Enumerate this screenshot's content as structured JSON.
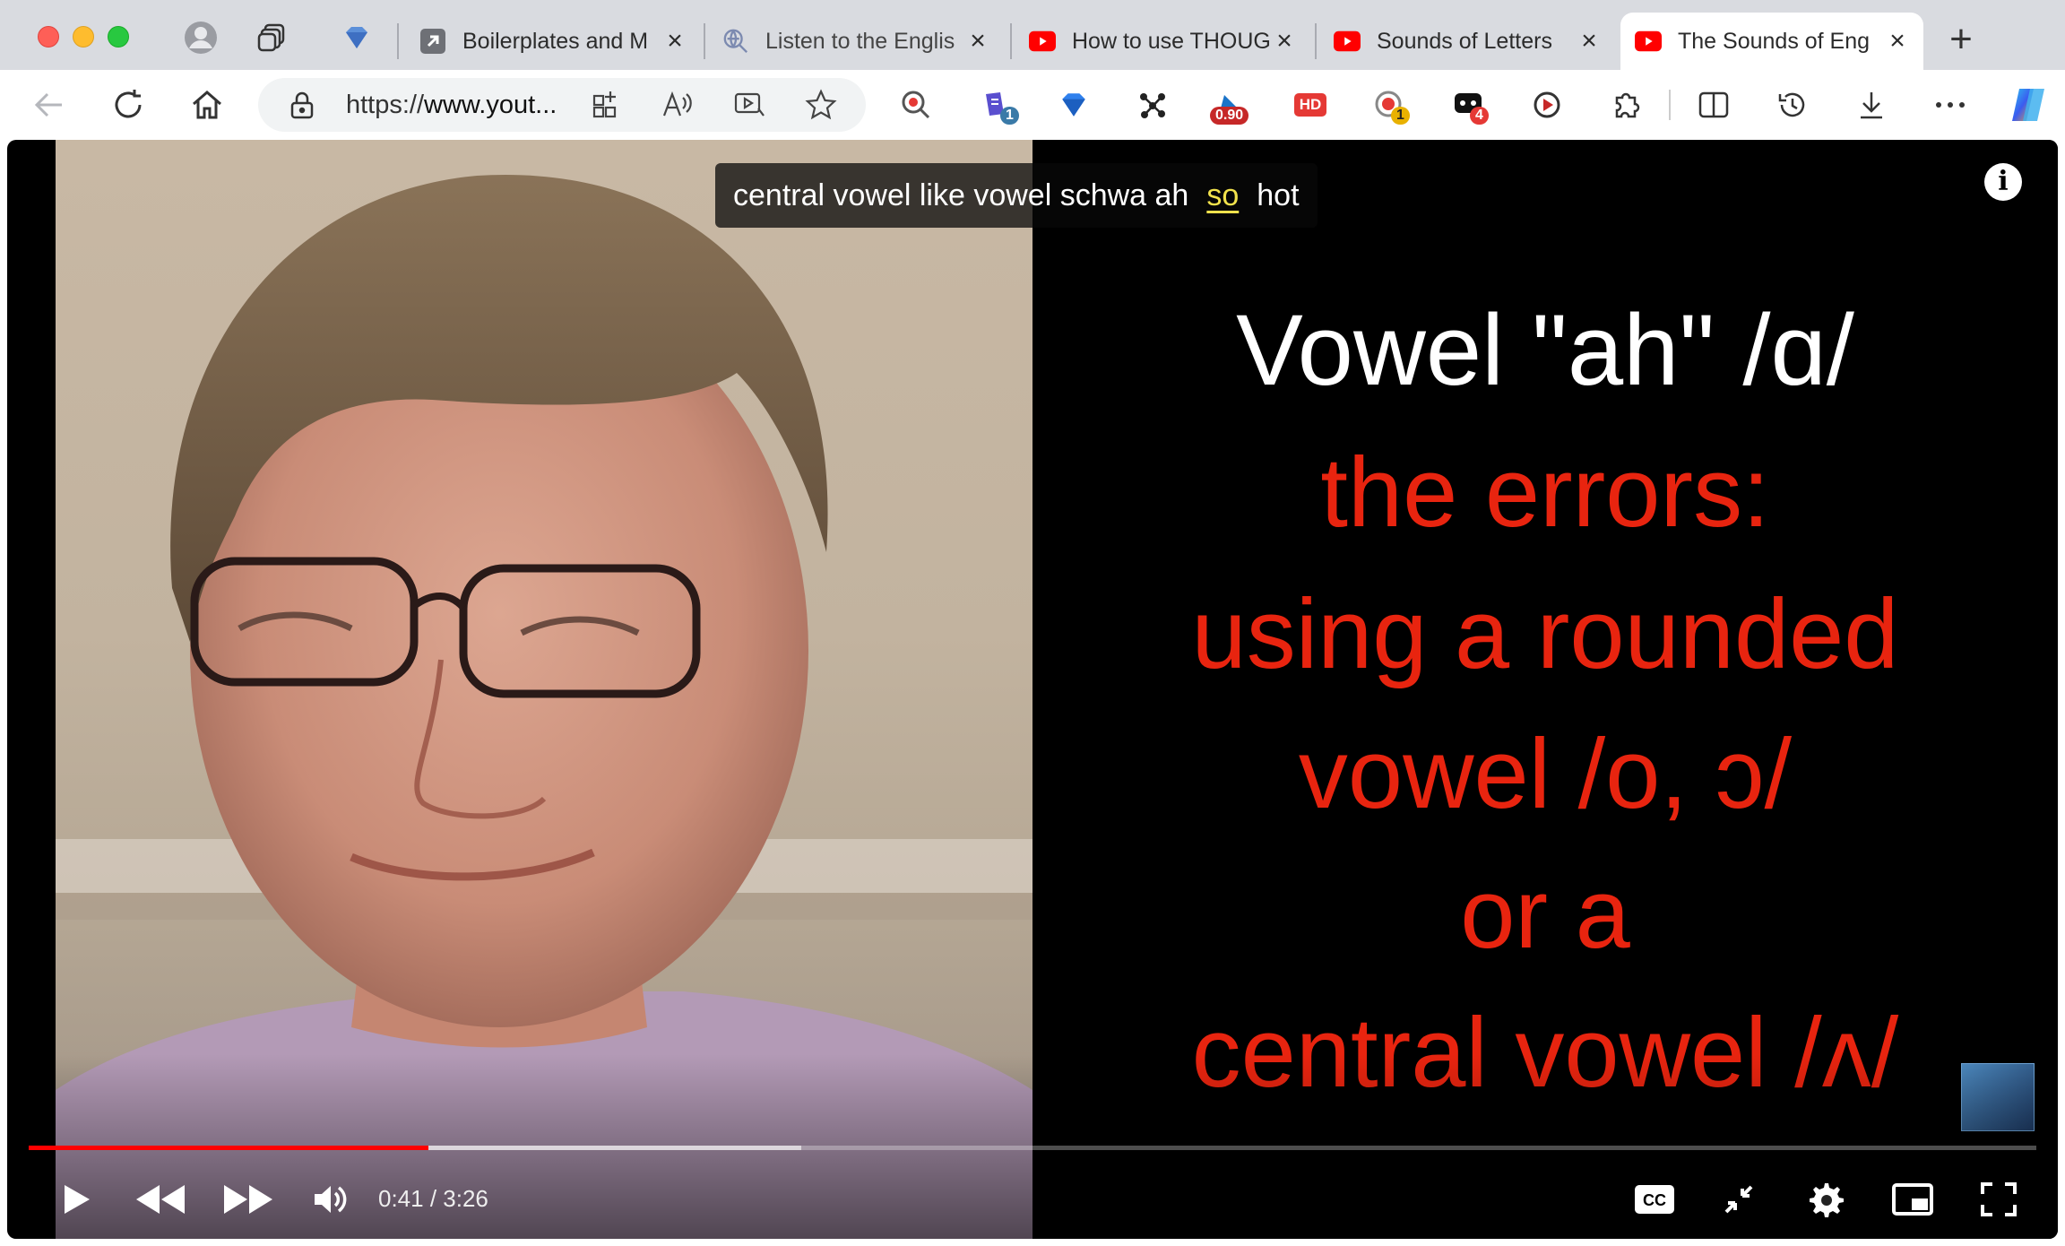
{
  "browser": {
    "tabs": [
      {
        "label": "Boilerplates and M",
        "favicon": "arrow-box-icon"
      },
      {
        "label": "Listen to the Englis",
        "favicon": "search-globe-icon"
      },
      {
        "label": "How to use THOUG",
        "favicon": "youtube-icon"
      },
      {
        "label": "Sounds of Letters",
        "favicon": "youtube-icon"
      },
      {
        "label": "The Sounds of Eng",
        "favicon": "youtube-icon",
        "active": true
      }
    ],
    "address_bar": {
      "url_prefix": "https://",
      "url_host": "www.yout...",
      "secure_icon": "lock-icon"
    },
    "extension_badges": {
      "ext_blue_doc": "1",
      "ext_speed": "0.90",
      "ext_hd": "HD",
      "ext_record": "1",
      "ext_chat": "4"
    },
    "accent_colors": {
      "youtube_red": "#ff0000",
      "tab_bar": "#d9dbe0"
    }
  },
  "video": {
    "caption": {
      "before": "central vowel like vowel schwa ah",
      "highlighted": "so",
      "after": "hot"
    },
    "slide": {
      "title": "Vowel \"ah\" /ɑ/",
      "lines": [
        "the errors:",
        "using a rounded",
        "vowel /o, ɔ/",
        "or a",
        "central vowel /ʌ/"
      ]
    },
    "info_label": "i",
    "player": {
      "current_time": "0:41",
      "duration": "3:26",
      "time_display": "0:41 / 3:26",
      "played_fraction": 0.199,
      "buffered_fraction": 0.385
    }
  }
}
